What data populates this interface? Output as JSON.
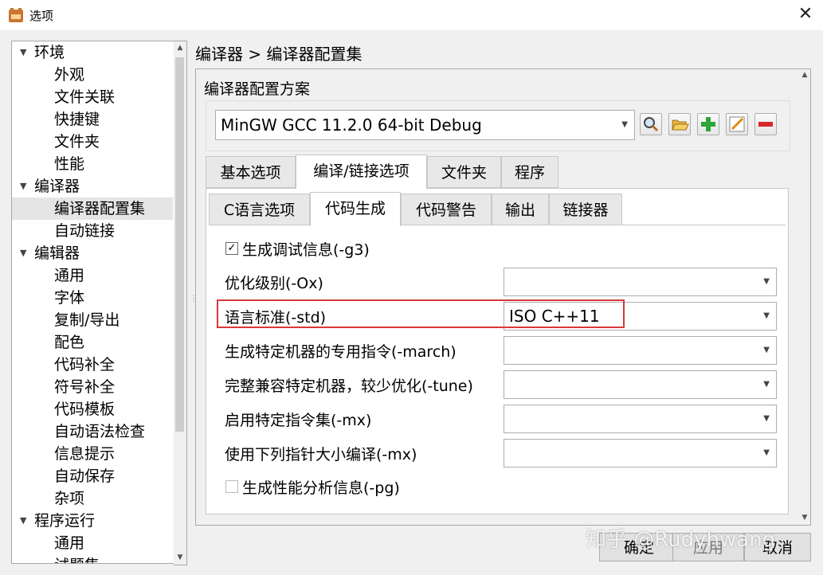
{
  "window": {
    "title": "选项"
  },
  "tree": {
    "items": [
      {
        "label": "环境",
        "level": 0,
        "expanded": true
      },
      {
        "label": "外观",
        "level": 1
      },
      {
        "label": "文件关联",
        "level": 1
      },
      {
        "label": "快捷键",
        "level": 1
      },
      {
        "label": "文件夹",
        "level": 1
      },
      {
        "label": "性能",
        "level": 1
      },
      {
        "label": "编译器",
        "level": 0,
        "expanded": true
      },
      {
        "label": "编译器配置集",
        "level": 1,
        "selected": true
      },
      {
        "label": "自动链接",
        "level": 1
      },
      {
        "label": "编辑器",
        "level": 0,
        "expanded": true
      },
      {
        "label": "通用",
        "level": 1
      },
      {
        "label": "字体",
        "level": 1
      },
      {
        "label": "复制/导出",
        "level": 1
      },
      {
        "label": "配色",
        "level": 1
      },
      {
        "label": "代码补全",
        "level": 1
      },
      {
        "label": "符号补全",
        "level": 1
      },
      {
        "label": "代码模板",
        "level": 1
      },
      {
        "label": "自动语法检查",
        "level": 1
      },
      {
        "label": "信息提示",
        "level": 1
      },
      {
        "label": "自动保存",
        "level": 1
      },
      {
        "label": "杂项",
        "level": 1
      },
      {
        "label": "程序运行",
        "level": 0,
        "expanded": true
      },
      {
        "label": "通用",
        "level": 1
      },
      {
        "label": "试题集",
        "level": 1
      }
    ]
  },
  "breadcrumb": "编译器 > 编译器配置集",
  "compiler_set": {
    "group_label": "编译器配置方案",
    "selected": "MinGW GCC 11.2.0 64-bit Debug",
    "tools": [
      "search-icon",
      "folder-icon",
      "add-icon",
      "edit-icon",
      "remove-icon"
    ]
  },
  "tabs": [
    {
      "label": "基本选项"
    },
    {
      "label": "编译/链接选项",
      "active": true
    },
    {
      "label": "文件夹"
    },
    {
      "label": "程序"
    }
  ],
  "subtabs": [
    {
      "label": "C语言选项"
    },
    {
      "label": "代码生成",
      "active": true
    },
    {
      "label": "代码警告"
    },
    {
      "label": "输出"
    },
    {
      "label": "链接器"
    }
  ],
  "options": {
    "debug_info": {
      "label": "生成调试信息(-g3)",
      "checked": true
    },
    "opt_level": {
      "label": "优化级别(-Ox)",
      "value": ""
    },
    "std": {
      "label": "语言标准(-std)",
      "value": "ISO C++11"
    },
    "march": {
      "label": "生成特定机器的专用指令(-march)",
      "value": ""
    },
    "tune": {
      "label": "完整兼容特定机器，较少优化(-tune)",
      "value": ""
    },
    "mx_set": {
      "label": "启用特定指令集(-mx)",
      "value": ""
    },
    "ptr_size": {
      "label": "使用下列指针大小编译(-mx)",
      "value": ""
    },
    "profile": {
      "label": "生成性能分析信息(-pg)",
      "checked": false
    }
  },
  "buttons": {
    "ok": "确定",
    "apply": "应用",
    "cancel": "取消"
  },
  "watermark": "知乎 @Rudyhwang",
  "colors": {
    "highlight_border": "#d8383a",
    "selected_bg": "#e5e5e5"
  }
}
